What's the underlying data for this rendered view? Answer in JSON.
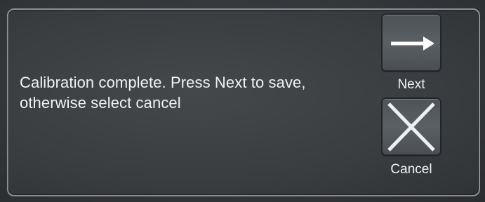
{
  "dialog": {
    "message_line1": "Calibration complete. Press Next to save,",
    "message_line2": "otherwise select cancel"
  },
  "buttons": {
    "next": {
      "label": "Next",
      "icon": "arrow-right-icon"
    },
    "cancel": {
      "label": "Cancel",
      "icon": "close-icon"
    }
  },
  "colors": {
    "panel": "#3a3d40",
    "border": "#8b9096",
    "text": "#f2f2f2",
    "button": "#565b5f"
  }
}
